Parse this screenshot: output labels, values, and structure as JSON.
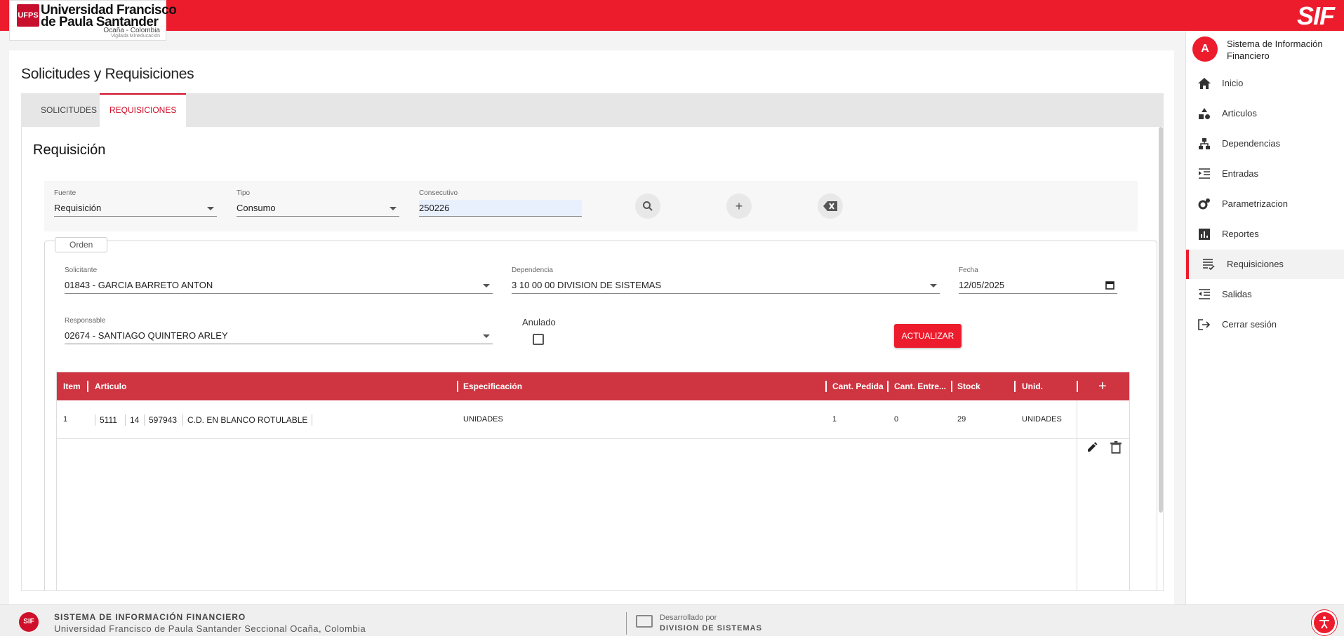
{
  "header": {
    "logo_mark": "UFPS",
    "logo_line1": "Universidad Francisco",
    "logo_line2": "de Paula Santander",
    "logo_line3": "Ocaña - Colombia",
    "logo_line4": "Vigilada Mineducación",
    "app_title": "SIF"
  },
  "page": {
    "title": "Solicitudes y Requisiciones",
    "tabs": [
      {
        "label": "SOLICITUDES"
      },
      {
        "label": "REQUISICIONES"
      }
    ],
    "section_title": "Requisición"
  },
  "filters": {
    "fuente": {
      "label": "Fuente",
      "value": "Requisición"
    },
    "tipo": {
      "label": "Tipo",
      "value": "Consumo"
    },
    "consecutivo": {
      "label": "Consecutivo",
      "value": "250226"
    }
  },
  "orden": {
    "legend": "Orden",
    "solicitante": {
      "label": "Solicitante",
      "value": "01843 - GARCIA BARRETO ANTON"
    },
    "dependencia": {
      "label": "Dependencia",
      "value": "3 10 00 00 DIVISION DE SISTEMAS"
    },
    "fecha": {
      "label": "Fecha",
      "value": "12/05/2025"
    },
    "responsable": {
      "label": "Responsable",
      "value": "02674 - SANTIAGO QUINTERO ARLEY"
    },
    "anulado_label": "Anulado",
    "anulado_checked": false,
    "actualizar_label": "ACTUALIZAR"
  },
  "grid": {
    "columns": [
      "Item",
      "Articulo",
      "Especificación",
      "Cant. Pedida",
      "Cant. Entre...",
      "Stock",
      "Unid."
    ],
    "add_icon": "+",
    "rows": [
      {
        "item": "1",
        "articulo": [
          "5111",
          "14",
          "597943",
          "C.D. EN BLANCO ROTULABLE"
        ],
        "especificacion": "UNIDADES",
        "cant_pedida": "1",
        "cant_entregada": "0",
        "stock": "29",
        "unidad": "UNIDADES"
      }
    ]
  },
  "sidebar": {
    "avatar_letter": "A",
    "title": "Sistema de Información Financiero",
    "items": [
      {
        "label": "Inicio",
        "icon": "home-icon"
      },
      {
        "label": "Articulos",
        "icon": "shapes-icon"
      },
      {
        "label": "Dependencias",
        "icon": "org-chart-icon"
      },
      {
        "label": "Entradas",
        "icon": "indent-icon"
      },
      {
        "label": "Parametrizacion",
        "icon": "gears-icon"
      },
      {
        "label": "Reportes",
        "icon": "bar-chart-icon"
      },
      {
        "label": "Requisiciones",
        "icon": "list-check-icon",
        "active": true
      },
      {
        "label": "Salidas",
        "icon": "outdent-icon"
      },
      {
        "label": "Cerrar sesión",
        "icon": "logout-icon"
      }
    ]
  },
  "footer": {
    "logo": "SIF",
    "title": "SISTEMA DE INFORMACIÓN FINANCIERO",
    "subtitle": "Universidad Francisco de Paula Santander Seccional Ocaña, Colombia",
    "dev_by": "Desarrollado por",
    "dev_name": "DIVISION DE SISTEMAS"
  },
  "colors": {
    "brand": "#ec1c2d",
    "grid_header": "#cf3541",
    "tab_active": "#d0102a"
  }
}
